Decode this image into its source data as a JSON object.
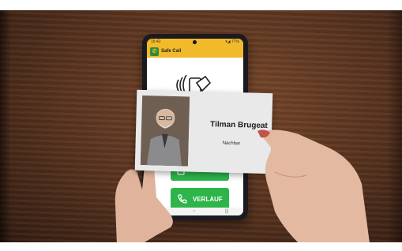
{
  "app": {
    "title": "Safe Call",
    "status_time": "15:42",
    "status_right": "▾◢ 77%"
  },
  "buttons": {
    "verlauf_label": "VERLAUF"
  },
  "card": {
    "name": "Tilman Brugeat",
    "role": "Nachbar"
  },
  "navbar": {
    "back": "‹",
    "home": "○",
    "recents": "|||"
  },
  "colors": {
    "appbar": "#f2b92a",
    "button_green": "#2db54a",
    "card_bg": "#e9e9ea",
    "table_wood": "#5c3520"
  },
  "icons": [
    "nfc-tap-icon",
    "app-logo-icon",
    "phone-icon"
  ]
}
